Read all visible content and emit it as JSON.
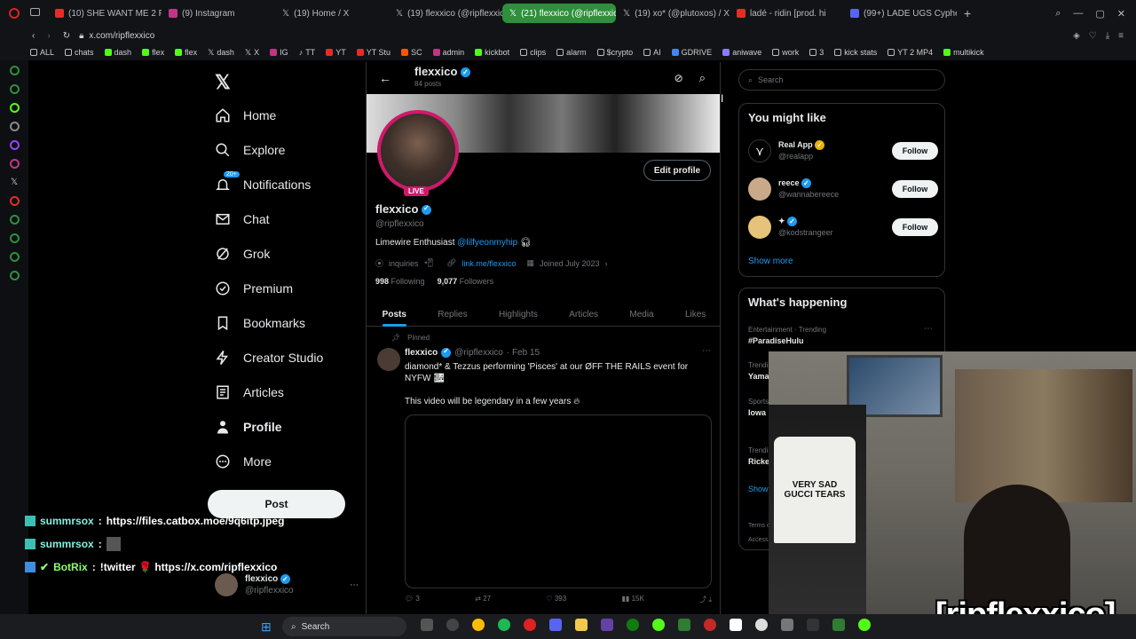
{
  "browser": {
    "tabs": [
      {
        "label": "(10) SHE WANT ME 2 PULL",
        "color": "#e52d27"
      },
      {
        "label": "(9) Instagram",
        "color": "#c13584"
      },
      {
        "label": "(19) Home / X",
        "color": "#ffffff"
      },
      {
        "label": "(19) flexxico (@ripflexxico",
        "color": "#ffffff"
      },
      {
        "label": "(21) flexxico (@ripflexxico",
        "color": "#ffffff"
      },
      {
        "label": "(19) xo* (@plutoxos) / X",
        "color": "#ffffff"
      },
      {
        "label": "ladé - ridin [prod. hi",
        "color": "#e52d27"
      },
      {
        "label": "(99+) LADE UGS Cyphe",
        "color": "#5865f2"
      }
    ],
    "url": "x.com/ripflexxico",
    "bookmarks": [
      "ALL",
      "chats",
      "dash",
      "flex",
      "flex",
      "dash",
      "X",
      "IG",
      "TT",
      "YT",
      "YT Stu",
      "SC",
      "admin",
      "kickbot",
      "clips",
      "alarm",
      "$crypto",
      "AI",
      "GDRIVE",
      "aniwave",
      "work",
      "3",
      "kick stats",
      "YT 2 MP4",
      "multikick"
    ]
  },
  "nav": {
    "items": [
      {
        "label": "Home"
      },
      {
        "label": "Explore"
      },
      {
        "label": "Notifications",
        "badge": "20+"
      },
      {
        "label": "Chat"
      },
      {
        "label": "Grok"
      },
      {
        "label": "Premium"
      },
      {
        "label": "Bookmarks"
      },
      {
        "label": "Creator Studio"
      },
      {
        "label": "Articles"
      },
      {
        "label": "Profile"
      },
      {
        "label": "More"
      }
    ],
    "post_label": "Post",
    "account": {
      "name": "flexxico",
      "handle": "@ripflexxico"
    }
  },
  "profile": {
    "header_name": "flexxico",
    "header_sub": "84 posts",
    "live_label": "LIVE",
    "edit_label": "Edit profile",
    "name": "flexxico",
    "handle": "@ripflexxico",
    "bio_text": "Limewire Enthusiast",
    "bio_mention": "@lilfyeonmyhip",
    "location": "inquiries",
    "link": "link.me/flexxico",
    "joined": "Joined July 2023",
    "following_count": "998",
    "following_label": "Following",
    "followers_count": "9,077",
    "followers_label": "Followers",
    "tabs": [
      "Posts",
      "Replies",
      "Highlights",
      "Articles",
      "Media",
      "Likes"
    ]
  },
  "tweet": {
    "pinned_label": "Pinned",
    "name": "flexxico",
    "handle": "@ripflexxico",
    "date": "· Feb 15",
    "text1": "diamond* & Tezzus performing 'Pisces' at our ØFF THE RAILS event for NYFW",
    "text2": "This video will be legendary in a few years",
    "replies": "3",
    "reposts": "27",
    "likes": "393",
    "views": "15K"
  },
  "sidebar": {
    "search_placeholder": "Search",
    "you_might_like": "You might like",
    "suggestions": [
      {
        "name": "Real App",
        "handle": "@realapp",
        "follow": "Follow"
      },
      {
        "name": "reece",
        "handle": "@wannabereece",
        "follow": "Follow"
      },
      {
        "name": "✦",
        "handle": "@kodstrangeer",
        "follow": "Follow"
      }
    ],
    "show_more": "Show more",
    "whats_happening": "What's happening",
    "trends": [
      {
        "meta": "Entertainment · Trending",
        "name": "#ParadiseHulu"
      },
      {
        "meta": "Trending",
        "name": "Yama"
      },
      {
        "meta": "Sports",
        "name": "Iowa"
      },
      {
        "meta": "Trending",
        "name": "Ricke"
      }
    ],
    "show_more2": "Show",
    "footer1": "Terms o",
    "footer2": "Access"
  },
  "stream": {
    "chat": [
      {
        "user": "summrsox",
        "sep": ":",
        "text": "https://files.catbox.moe/9q6itp.jpeg",
        "color": "#7cf2e0"
      },
      {
        "user": "summrsox",
        "sep": ":",
        "text": "",
        "color": "#7cf2e0"
      },
      {
        "user": "BotRix",
        "sep": ":",
        "text": "!twitter 🌹 https://x.com/ripflexxico",
        "color": "#8bff6c"
      }
    ],
    "shirt_text": "VERY SAD GUCCI TEARS",
    "watermark": "[ripflexxico]"
  },
  "taskbar": {
    "search_label": "Search"
  }
}
